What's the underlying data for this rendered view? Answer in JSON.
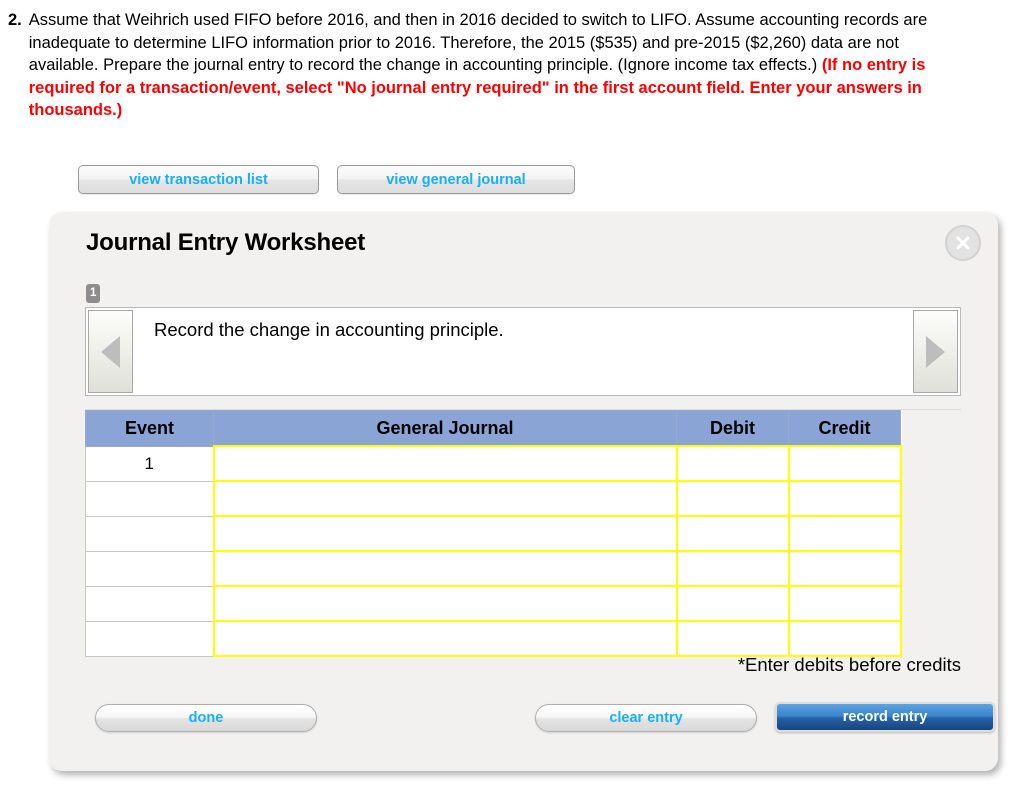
{
  "question": {
    "number": "2.",
    "text_plain": "Assume that Weihrich used FIFO before 2016, and then in 2016 decided to switch to LIFO. Assume accounting records are inadequate to determine LIFO information prior to 2016. Therefore, the 2015 ($535) and pre-2015 ($2,260) data are not available. Prepare the journal entry to record the change in accounting principle. (Ignore income tax effects.) ",
    "text_emphasis": "(If no entry is required for a transaction/event, select \"No journal entry required\" in the first account field. Enter your answers in thousands.)",
    "emphasis_color": "#ff0000"
  },
  "view_buttons": {
    "transaction_list": "view transaction list",
    "general_journal": "view general journal"
  },
  "worksheet": {
    "title": "Journal Entry Worksheet",
    "close_icon": "close-x-icon",
    "tab_badge": "1",
    "prev_icon": "chevron-left-icon",
    "next_icon": "chevron-right-icon",
    "description": "Record the change in accounting principle.",
    "note": "*Enter debits before credits",
    "table": {
      "headers": [
        "Event",
        "General Journal",
        "Debit",
        "Credit"
      ],
      "rows": [
        {
          "event": "1",
          "general_journal": "",
          "debit": "",
          "credit": ""
        },
        {
          "event": "",
          "general_journal": "",
          "debit": "",
          "credit": ""
        },
        {
          "event": "",
          "general_journal": "",
          "debit": "",
          "credit": ""
        },
        {
          "event": "",
          "general_journal": "",
          "debit": "",
          "credit": ""
        },
        {
          "event": "",
          "general_journal": "",
          "debit": "",
          "credit": ""
        },
        {
          "event": "",
          "general_journal": "",
          "debit": "",
          "credit": ""
        }
      ],
      "header_color": "#8ba4d6",
      "input_border_color": "#ffff00"
    },
    "buttons": {
      "done": "done",
      "clear_entry": "clear entry",
      "record_entry": "record entry"
    }
  }
}
